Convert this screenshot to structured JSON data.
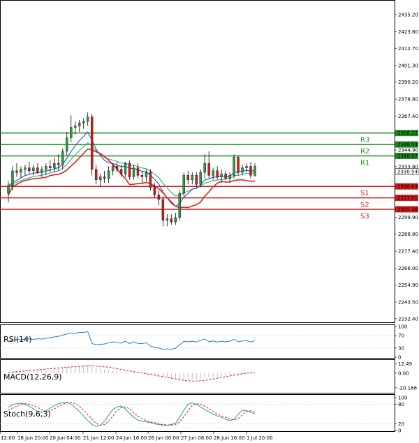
{
  "chart_data": {
    "type": "candlestick",
    "x_tick_labels": [
      "12:00",
      "18 Jun 20:00",
      "20 Jun 04:00",
      "21 Jun 12:00",
      "24 Jun 16:00",
      "26 Jun 00:00",
      "27 Jun 08:00",
      "28 Jun 16:00",
      "1 Jul 20:00"
    ],
    "price_axis": {
      "ticks": [
        "2435.20",
        "2423.80",
        "2412.70",
        "2401.30",
        "2390.20",
        "2378.80",
        "2367.40",
        "2344.90",
        "2333.80",
        "2299.90",
        "2288.80",
        "2277.40",
        "2266.00",
        "2254.90",
        "2243.50",
        "2232.40"
      ],
      "range": [
        2230,
        2444
      ]
    },
    "current_price": "2330.54",
    "resistance_levels": [
      {
        "name": "R1",
        "price": "2340.97",
        "value": 2340.97
      },
      {
        "name": "R2",
        "price": "2348.59",
        "value": 2348.59
      },
      {
        "name": "R3",
        "price": "2356.22",
        "value": 2356.22
      }
    ],
    "support_levels": [
      {
        "name": "S1",
        "price": "2320.63",
        "value": 2320.63
      },
      {
        "name": "S2",
        "price": "2313.01",
        "value": 2313.01
      },
      {
        "name": "S3",
        "price": "2305.38",
        "value": 2305.38
      }
    ],
    "candles": [
      {
        "o": 2316,
        "h": 2324,
        "l": 2310,
        "c": 2321
      },
      {
        "o": 2321,
        "h": 2334,
        "l": 2318,
        "c": 2331
      },
      {
        "o": 2331,
        "h": 2336,
        "l": 2327,
        "c": 2330
      },
      {
        "o": 2330,
        "h": 2334,
        "l": 2326,
        "c": 2332
      },
      {
        "o": 2332,
        "h": 2335,
        "l": 2328,
        "c": 2333
      },
      {
        "o": 2333,
        "h": 2337,
        "l": 2329,
        "c": 2331
      },
      {
        "o": 2331,
        "h": 2335,
        "l": 2328,
        "c": 2333
      },
      {
        "o": 2333,
        "h": 2336,
        "l": 2329,
        "c": 2330
      },
      {
        "o": 2330,
        "h": 2334,
        "l": 2327,
        "c": 2332
      },
      {
        "o": 2332,
        "h": 2336,
        "l": 2328,
        "c": 2334
      },
      {
        "o": 2334,
        "h": 2338,
        "l": 2330,
        "c": 2333
      },
      {
        "o": 2333,
        "h": 2340,
        "l": 2330,
        "c": 2336
      },
      {
        "o": 2336,
        "h": 2342,
        "l": 2331,
        "c": 2335
      },
      {
        "o": 2335,
        "h": 2346,
        "l": 2332,
        "c": 2344
      },
      {
        "o": 2344,
        "h": 2357,
        "l": 2341,
        "c": 2353
      },
      {
        "o": 2353,
        "h": 2368,
        "l": 2350,
        "c": 2360
      },
      {
        "o": 2360,
        "h": 2364,
        "l": 2355,
        "c": 2361
      },
      {
        "o": 2361,
        "h": 2365,
        "l": 2357,
        "c": 2363
      },
      {
        "o": 2363,
        "h": 2366,
        "l": 2359,
        "c": 2364
      },
      {
        "o": 2364,
        "h": 2370,
        "l": 2361,
        "c": 2367
      },
      {
        "o": 2367,
        "h": 2369,
        "l": 2328,
        "c": 2332
      },
      {
        "o": 2332,
        "h": 2335,
        "l": 2322,
        "c": 2325
      },
      {
        "o": 2325,
        "h": 2329,
        "l": 2321,
        "c": 2327
      },
      {
        "o": 2327,
        "h": 2331,
        "l": 2323,
        "c": 2326
      },
      {
        "o": 2326,
        "h": 2334,
        "l": 2323,
        "c": 2331
      },
      {
        "o": 2331,
        "h": 2336,
        "l": 2328,
        "c": 2334
      },
      {
        "o": 2334,
        "h": 2337,
        "l": 2330,
        "c": 2332
      },
      {
        "o": 2332,
        "h": 2335,
        "l": 2327,
        "c": 2329
      },
      {
        "o": 2329,
        "h": 2337,
        "l": 2327,
        "c": 2336
      },
      {
        "o": 2336,
        "h": 2338,
        "l": 2325,
        "c": 2327
      },
      {
        "o": 2327,
        "h": 2335,
        "l": 2325,
        "c": 2333
      },
      {
        "o": 2333,
        "h": 2336,
        "l": 2326,
        "c": 2328
      },
      {
        "o": 2328,
        "h": 2331,
        "l": 2323,
        "c": 2327
      },
      {
        "o": 2327,
        "h": 2332,
        "l": 2324,
        "c": 2330
      },
      {
        "o": 2330,
        "h": 2332,
        "l": 2318,
        "c": 2320
      },
      {
        "o": 2320,
        "h": 2323,
        "l": 2313,
        "c": 2315
      },
      {
        "o": 2315,
        "h": 2318,
        "l": 2308,
        "c": 2312
      },
      {
        "o": 2312,
        "h": 2314,
        "l": 2294,
        "c": 2298
      },
      {
        "o": 2298,
        "h": 2302,
        "l": 2294,
        "c": 2299
      },
      {
        "o": 2299,
        "h": 2302,
        "l": 2295,
        "c": 2297
      },
      {
        "o": 2297,
        "h": 2303,
        "l": 2295,
        "c": 2300
      },
      {
        "o": 2300,
        "h": 2318,
        "l": 2298,
        "c": 2316
      },
      {
        "o": 2316,
        "h": 2330,
        "l": 2314,
        "c": 2328
      },
      {
        "o": 2328,
        "h": 2331,
        "l": 2322,
        "c": 2325
      },
      {
        "o": 2325,
        "h": 2330,
        "l": 2322,
        "c": 2328
      },
      {
        "o": 2328,
        "h": 2330,
        "l": 2320,
        "c": 2322
      },
      {
        "o": 2322,
        "h": 2332,
        "l": 2320,
        "c": 2330
      },
      {
        "o": 2330,
        "h": 2342,
        "l": 2326,
        "c": 2336
      },
      {
        "o": 2336,
        "h": 2344,
        "l": 2326,
        "c": 2328
      },
      {
        "o": 2328,
        "h": 2333,
        "l": 2325,
        "c": 2331
      },
      {
        "o": 2331,
        "h": 2334,
        "l": 2325,
        "c": 2327
      },
      {
        "o": 2327,
        "h": 2332,
        "l": 2323,
        "c": 2329
      },
      {
        "o": 2329,
        "h": 2331,
        "l": 2325,
        "c": 2326
      },
      {
        "o": 2326,
        "h": 2330,
        "l": 2323,
        "c": 2328
      },
      {
        "o": 2328,
        "h": 2342,
        "l": 2326,
        "c": 2340
      },
      {
        "o": 2340,
        "h": 2341,
        "l": 2328,
        "c": 2330
      },
      {
        "o": 2330,
        "h": 2335,
        "l": 2328,
        "c": 2333
      },
      {
        "o": 2333,
        "h": 2336,
        "l": 2330,
        "c": 2334
      },
      {
        "o": 2334,
        "h": 2337,
        "l": 2326,
        "c": 2328
      },
      {
        "o": 2328,
        "h": 2336,
        "l": 2327,
        "c": 2334
      }
    ],
    "rsi": {
      "label": "RSI(14)",
      "ticks": [
        "100",
        "70",
        "30",
        "0"
      ],
      "range": [
        0,
        100
      ],
      "values": [
        52,
        55,
        58,
        57,
        59,
        60,
        58,
        60,
        59,
        62,
        63,
        66,
        68,
        72,
        76,
        79,
        78,
        80,
        81,
        83,
        45,
        40,
        42,
        43,
        47,
        50,
        48,
        46,
        52,
        44,
        50,
        45,
        44,
        47,
        36,
        32,
        30,
        26,
        27,
        26,
        29,
        40,
        52,
        50,
        52,
        49,
        55,
        59,
        50,
        53,
        49,
        52,
        50,
        52,
        58,
        50,
        53,
        54,
        49,
        54
      ]
    },
    "macd": {
      "label": "MACD(12,26,9)",
      "ticks": [
        "12.49",
        "0.00",
        "-20.166"
      ],
      "range": [
        -26,
        16
      ],
      "hist": [
        2,
        2,
        3,
        3,
        3,
        4,
        4,
        4,
        4,
        5,
        5,
        6,
        6,
        7,
        8,
        9,
        9,
        10,
        10,
        11,
        9,
        7,
        6,
        5,
        4,
        3,
        3,
        2,
        2,
        1,
        1,
        0,
        0,
        -1,
        -2,
        -3,
        -4,
        -5,
        -6,
        -7,
        -8,
        -9,
        -9,
        -9,
        -8,
        -8,
        -7,
        -6,
        -6,
        -5,
        -5,
        -4,
        -4,
        -3,
        -3,
        -2,
        -2,
        -1,
        -1,
        0
      ],
      "signal": [
        1,
        1.5,
        2,
        2.5,
        3,
        3.5,
        4,
        4.5,
        5,
        5.5,
        6,
        6.5,
        7,
        7.5,
        8,
        8.5,
        9,
        9,
        9.5,
        10,
        10,
        9.5,
        9,
        8.5,
        8,
        7,
        6,
        5,
        4,
        3,
        2,
        1,
        0,
        -1,
        -2,
        -3,
        -4,
        -5,
        -6,
        -7,
        -8,
        -9,
        -10,
        -10.5,
        -11,
        -11,
        -10.5,
        -10,
        -9,
        -8,
        -7,
        -6,
        -5,
        -4,
        -3,
        -2,
        -1,
        0,
        0.5,
        1
      ]
    },
    "stoch": {
      "label": "Stoch(9,6,3)",
      "ticks": [
        "100",
        "80",
        "20",
        "0"
      ],
      "range": [
        0,
        100
      ],
      "main": [
        70,
        78,
        82,
        83,
        80,
        74,
        66,
        58,
        55,
        60,
        68,
        76,
        82,
        85,
        86,
        80,
        70,
        58,
        44,
        30,
        18,
        12,
        16,
        28,
        46,
        64,
        72,
        74,
        66,
        52,
        40,
        32,
        28,
        26,
        24,
        20,
        18,
        16,
        16,
        18,
        22,
        40,
        62,
        80,
        84,
        80,
        72,
        64,
        56,
        50,
        44,
        40,
        34,
        30,
        34,
        50,
        62,
        60,
        56,
        50
      ],
      "signal": [
        62,
        68,
        74,
        79,
        82,
        80,
        76,
        70,
        62,
        58,
        60,
        66,
        74,
        80,
        84,
        86,
        82,
        74,
        62,
        48,
        34,
        22,
        16,
        18,
        28,
        44,
        60,
        70,
        72,
        66,
        54,
        44,
        36,
        30,
        26,
        24,
        20,
        18,
        17,
        16,
        18,
        26,
        42,
        60,
        76,
        82,
        80,
        74,
        66,
        58,
        50,
        44,
        40,
        36,
        32,
        36,
        48,
        58,
        60,
        56
      ]
    }
  }
}
